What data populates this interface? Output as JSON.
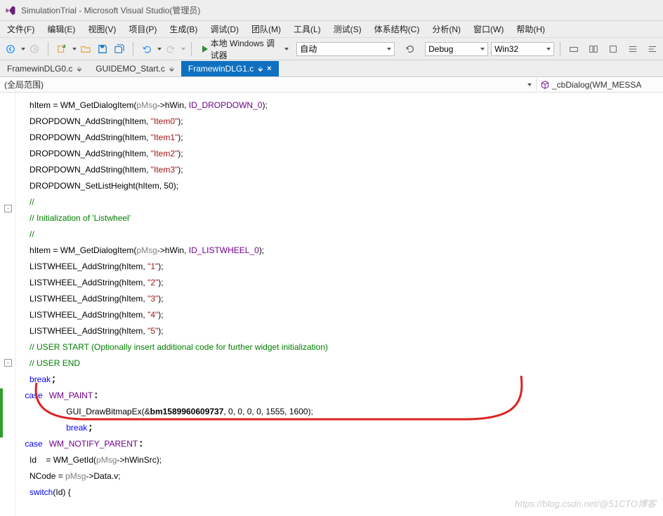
{
  "title": "SimulationTrial - Microsoft Visual Studio(管理员)",
  "menu": {
    "file": "文件(F)",
    "edit": "编辑(E)",
    "view": "视图(V)",
    "project": "项目(P)",
    "build": "生成(B)",
    "debug": "调试(D)",
    "team": "团队(M)",
    "tools": "工具(L)",
    "test": "测试(S)",
    "arch": "体系结构(C)",
    "analyze": "分析(N)",
    "window": "窗口(W)",
    "help": "帮助(H)"
  },
  "toolbar": {
    "debugger": "本地 Windows 调试器",
    "combo_auto": "自动",
    "config": "Debug",
    "platform": "Win32"
  },
  "tabs": [
    {
      "label": "FramewinDLG0.c",
      "active": false,
      "pinned": true
    },
    {
      "label": "GUIDEMO_Start.c",
      "active": false,
      "pinned": true
    },
    {
      "label": "FramewinDLG1.c",
      "active": true,
      "pinned": true
    }
  ],
  "nav": {
    "scope": "(全局范围)",
    "member": "_cbDialog(WM_MESSA"
  },
  "code": {
    "indent2": "    ",
    "indent3": "      ",
    "l1a": "hItem = WM_GetDialogItem(",
    "l1b": "pMsg",
    "l1c": "->hWin, ",
    "l1d": "ID_DROPDOWN_0",
    "l1e": ");",
    "d0a": "DROPDOWN_AddString(hItem, ",
    "d0b": "\"Item0\"",
    "d0c": ");",
    "d1b": "\"Item1\"",
    "d2b": "\"Item2\"",
    "d3b": "\"Item3\"",
    "dha": "DROPDOWN_SetListHeight(hItem, 50);",
    "slsl": "//",
    "cmt_init": "// Initialization of 'Listwheel'",
    "lw_id": "ID_LISTWHEEL_0",
    "lwa": "LISTWHEEL_AddString(hItem, ",
    "lw1": "\"1\"",
    "lw2": "\"2\"",
    "lw3": "\"3\"",
    "lw4": "\"4\"",
    "lw5": "\"5\"",
    "cmt_us": "// USER START (Optionally insert additional code for further widget initialization)",
    "cmt_ue": "// USER END",
    "break": "break",
    "case": "case",
    "wm_paint": "WM_PAINT",
    "gui1": "GUI_DrawBitmapEx(&",
    "gui_bm": "bm1589960609737",
    "gui2": ", 0, 0, 0, 0, 1555, 1600);",
    "wm_np": "WM_NOTIFY_PARENT",
    "id_line_a": "Id    = WM_GetId(",
    "id_line_b": "pMsg",
    "id_line_c": "->hWinSrc);",
    "nc_a": "NCode = ",
    "nc_b": "pMsg",
    "nc_c": "->Data.v;",
    "sw": "switch",
    "sw_end": "(Id) {"
  },
  "watermark": "https://blog.csdn.net/@51CTO博客"
}
